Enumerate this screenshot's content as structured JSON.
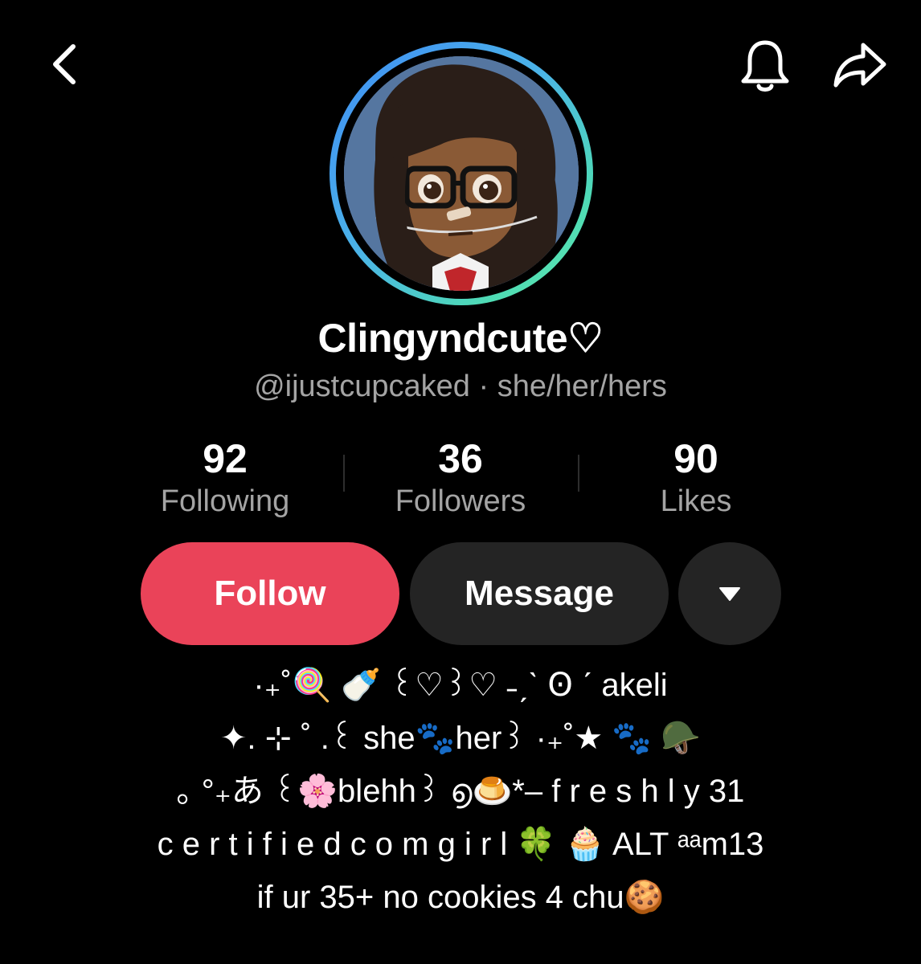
{
  "header": {
    "back_icon": "chevron-left-icon",
    "bell_icon": "bell-icon",
    "share_icon": "share-arrow-icon"
  },
  "profile": {
    "display_name": "Clingyndcute♡",
    "username": "@ijustcupcaked",
    "separator": " · ",
    "pronouns": "she/her/hers",
    "avatar_ring_colors": [
      "#3f8cf5",
      "#4fdcb4",
      "#66ebb1"
    ]
  },
  "stats": [
    {
      "value": "92",
      "label": "Following"
    },
    {
      "value": "36",
      "label": "Followers"
    },
    {
      "value": "90",
      "label": "Likes"
    }
  ],
  "actions": {
    "follow_label": "Follow",
    "message_label": "Message",
    "more_icon": "caret-down-icon",
    "follow_color": "#ea4359"
  },
  "bio": {
    "lines": [
      "·₊˚🍭 🍼 ꒰♡꒱♡ ˗ˏˋ Ꙩ ˊ akeli",
      "✦. ⊹ ˚ .꒰ she🐾her꒱ ·₊˚★ 🐾 🪖",
      "｡ °₊あ ꒰🌸blehh꒱ ൭🍮*‒ f r e s h l y 31",
      "c e r t i f i e d c o m g i r l 🍀 🧁 ALT ᵃᵃm13",
      "if ur 35+ no cookies 4 chu🍪"
    ]
  }
}
